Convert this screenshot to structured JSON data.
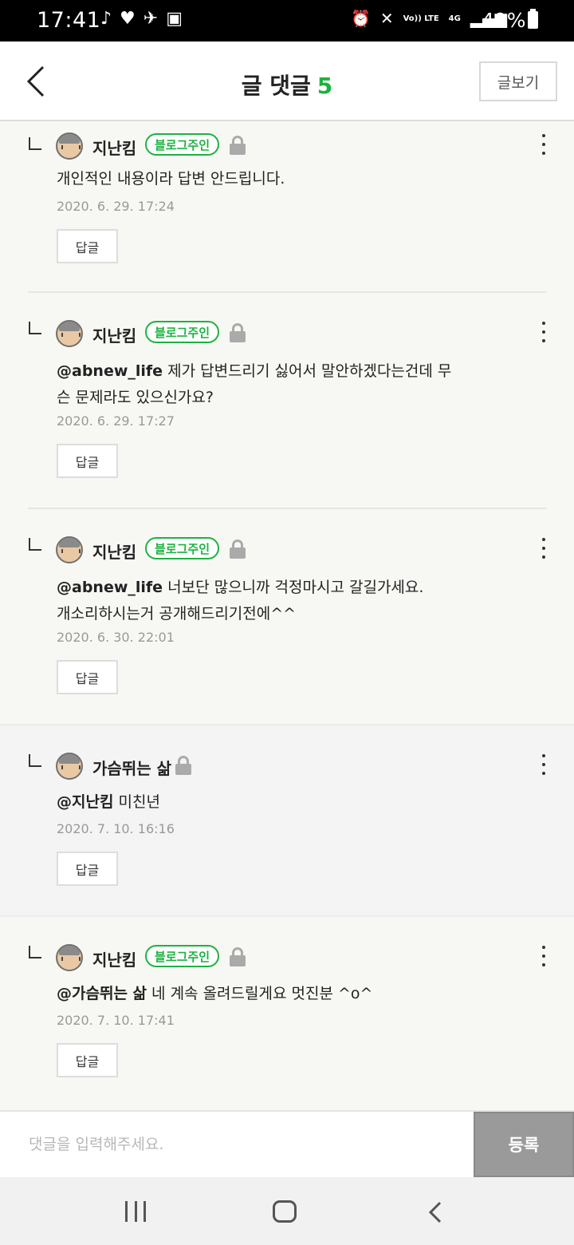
{
  "status_bar": {
    "time": "17:41",
    "left_icons": [
      "music-note-icon",
      "heart-icon",
      "satellite-icon",
      "image-icon"
    ],
    "right_icons": [
      "alarm-icon",
      "mute-icon",
      "volte-icon",
      "4g-icon",
      "signal-icon"
    ],
    "volte": "Vo)) LTE",
    "network": "4G",
    "battery": "49%"
  },
  "header": {
    "title": "글 댓글",
    "count": "5",
    "post_view_label": "글보기"
  },
  "comments": [
    {
      "nick": "지난킴",
      "badge": "블로그주인",
      "mention": "",
      "text": "개인적인 내용이라 답변 안드립니다.",
      "date": "2020. 6. 29. 17:24",
      "reply_label": "답글"
    },
    {
      "nick": "지난킴",
      "badge": "블로그주인",
      "mention": "@abnew_life",
      "text": " 제가 답변드리기 싫어서 말안하겠다는건데 무슨 문제라도 있으신가요?",
      "date": "2020. 6. 29. 17:27",
      "reply_label": "답글"
    },
    {
      "nick": "지난킴",
      "badge": "블로그주인",
      "mention": "@abnew_life",
      "text": " 너보단 많으니까 걱정마시고 갈길가세요. 개소리하시는거 공개해드리기전에^^",
      "date": "2020. 6. 30. 22:01",
      "reply_label": "답글"
    },
    {
      "nick": "가슴뛰는 삶",
      "badge": "",
      "mention": "@지난킴",
      "text": " 미친년",
      "date": "2020. 7. 10. 16:16",
      "reply_label": "답글"
    },
    {
      "nick": "지난킴",
      "badge": "블로그주인",
      "mention": "@가슴뛰는 삶",
      "text": " 네 계속 올려드릴게요 멋진분 ^o^",
      "date": "2020. 7. 10. 17:41",
      "reply_label": "답글"
    }
  ],
  "input": {
    "placeholder": "댓글을 입력해주세요.",
    "submit_label": "등록"
  },
  "colors": {
    "accent_green": "#1db240",
    "submit_gray": "#9a9a9a"
  }
}
